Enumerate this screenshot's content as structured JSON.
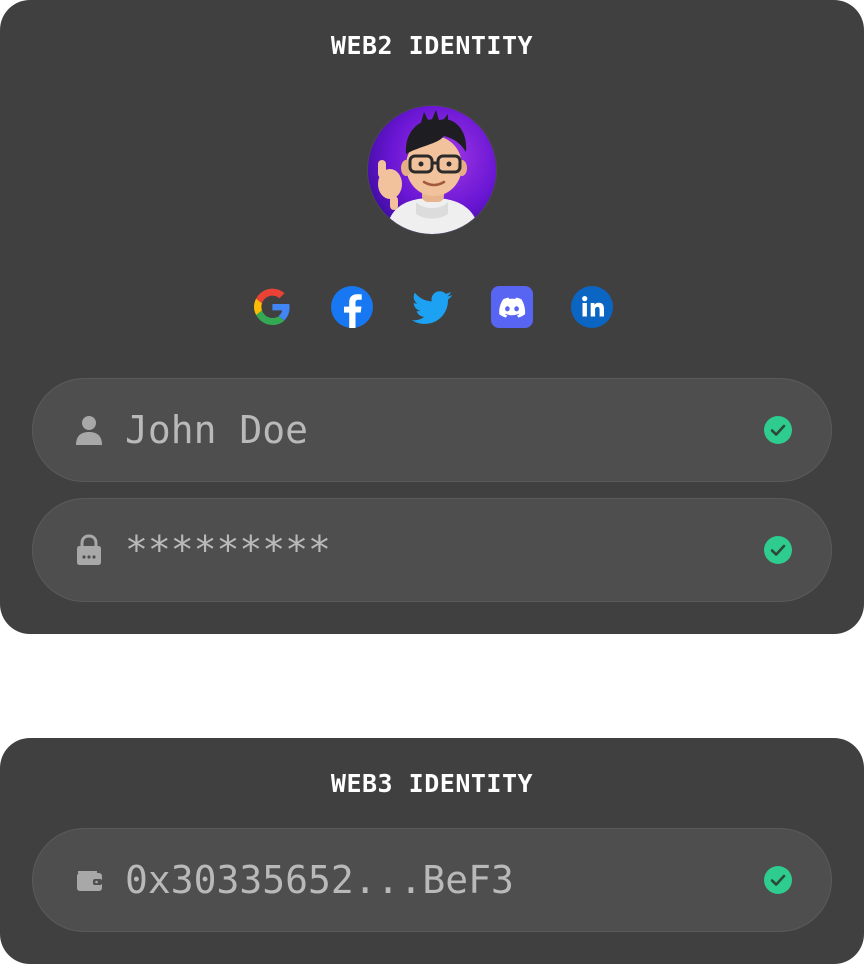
{
  "web2": {
    "title": "WEB2 IDENTITY",
    "avatar_alt": "memoji avatar",
    "socials": [
      {
        "name": "google",
        "icon": "google-icon"
      },
      {
        "name": "facebook",
        "icon": "facebook-icon"
      },
      {
        "name": "twitter",
        "icon": "twitter-icon"
      },
      {
        "name": "discord",
        "icon": "discord-icon"
      },
      {
        "name": "linkedin",
        "icon": "linkedin-icon"
      }
    ],
    "username": {
      "value": "John Doe",
      "icon": "user-icon",
      "verified": true
    },
    "password": {
      "value": "*********",
      "icon": "lock-icon",
      "verified": true
    }
  },
  "web3": {
    "title": "WEB3 IDENTITY",
    "wallet": {
      "value": "0x30335652...BeF3",
      "icon": "wallet-icon",
      "verified": true
    }
  },
  "colors": {
    "card_bg": "#404040",
    "field_bg": "#4e4e4e",
    "text_muted": "#b9b9b9",
    "verified_green": "#2ecc8f",
    "title": "#ffffff"
  }
}
